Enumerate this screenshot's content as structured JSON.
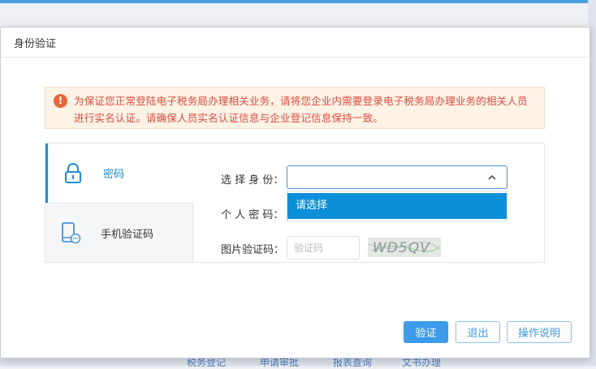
{
  "background": {
    "links": [
      "税务登记",
      "申请审批",
      "报表查询",
      "文书办理"
    ]
  },
  "dialog": {
    "title": "身份验证",
    "notice": "为保证您正常登陆电子税务局办理相关业务，请将您企业内需要登录电子税务局办理业务的相关人员进行实名认证。请确保人员实名认证信息与企业登记信息保持一致。",
    "tabs": [
      {
        "label": "密码",
        "icon": "lock-icon",
        "active": true
      },
      {
        "label": "手机验证码",
        "icon": "phone-message-icon",
        "active": false
      }
    ],
    "form": {
      "identity_label": "选 择 身 份：",
      "identity_value": "",
      "dropdown_options": [
        "请选择"
      ],
      "password_label": "个 人 密 码：",
      "captcha_label": "图片验证码：",
      "captcha_placeholder": "验证码",
      "captcha_text": "WD5QV"
    },
    "buttons": {
      "verify": "验证",
      "exit": "退出",
      "help": "操作说明"
    }
  },
  "colors": {
    "primary": "#3c9bea",
    "notice_text": "#e64b3b",
    "notice_bg": "#fdf2e6",
    "warning_icon": "#e8663a",
    "dropdown_highlight": "#0b8fd8"
  }
}
